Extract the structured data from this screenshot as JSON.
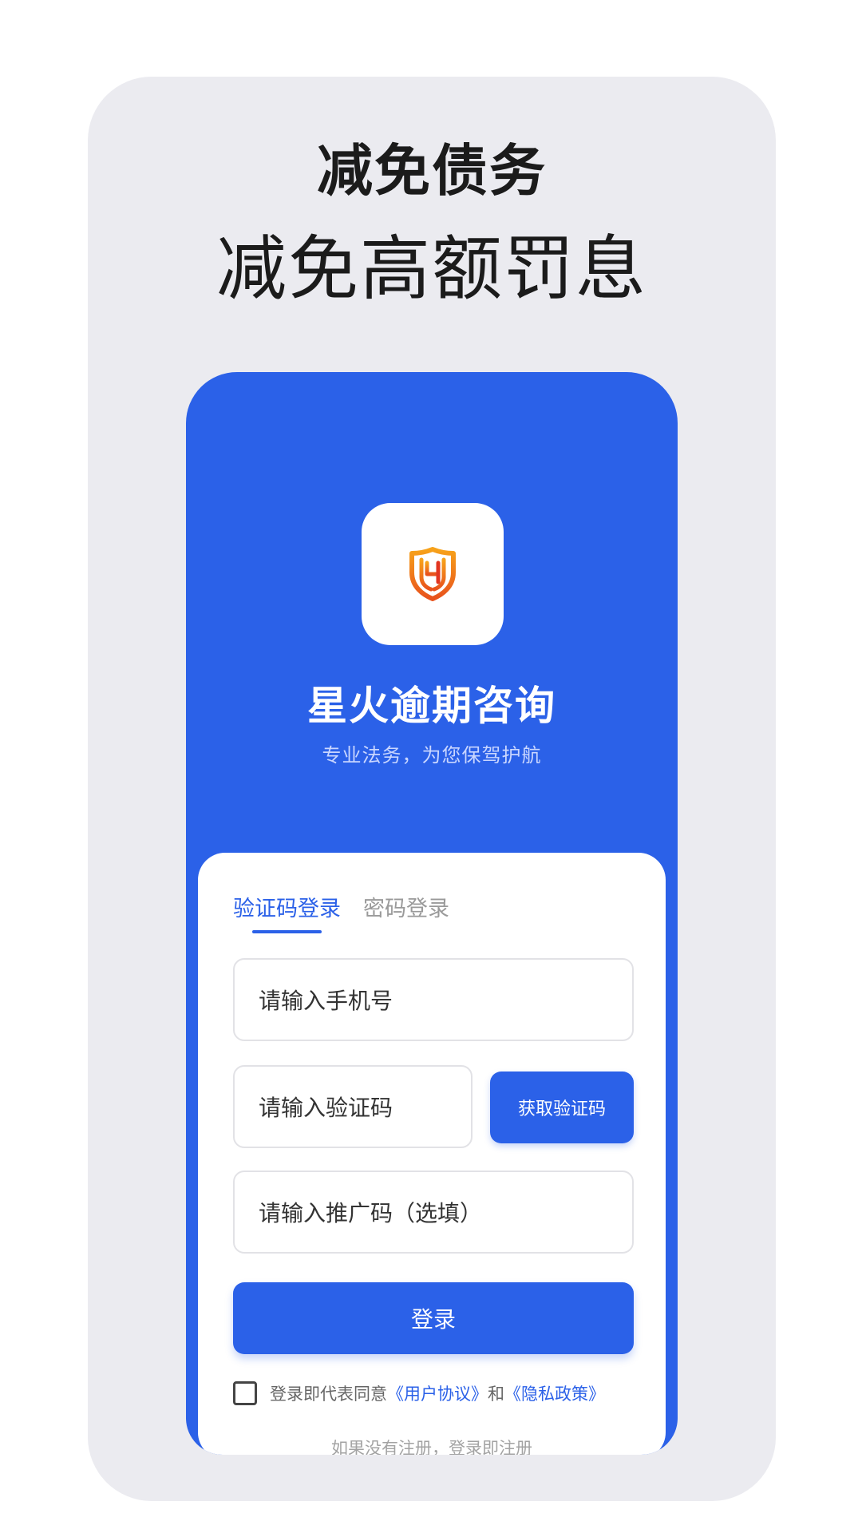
{
  "promo": {
    "headline_1": "减免债务",
    "headline_2": "减免高额罚息"
  },
  "app": {
    "name": "星火逾期咨询",
    "slogan": "专业法务，为您保驾护航",
    "logo_icon": "shield-logo-icon",
    "colors": {
      "primary": "#2b61e8",
      "logo_orange": "#f08a16",
      "logo_red": "#e2351f"
    }
  },
  "login": {
    "tabs": [
      {
        "label": "验证码登录",
        "active": true
      },
      {
        "label": "密码登录",
        "active": false
      }
    ],
    "phone_placeholder": "请输入手机号",
    "code_placeholder": "请输入验证码",
    "promo_code_placeholder": "请输入推广码（选填）",
    "get_code_label": "获取验证码",
    "login_label": "登录",
    "agreement": {
      "prefix": "登录即代表同意",
      "user_agreement": "《用户协议》",
      "joiner": "和",
      "privacy_policy": "《隐私政策》",
      "checked": false
    },
    "register_hint": "如果没有注册，登录即注册"
  }
}
